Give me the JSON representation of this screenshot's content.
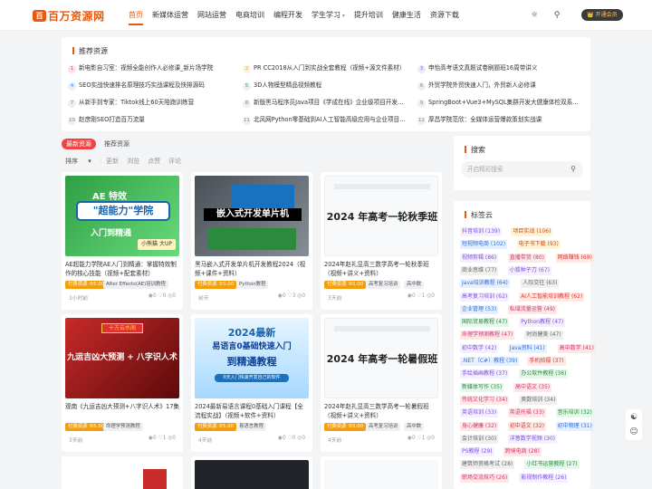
{
  "header": {
    "logo_mark": "百",
    "logo_text": "百万资源网",
    "nav": [
      {
        "label": "首页",
        "active": true
      },
      {
        "label": "新媒体运营"
      },
      {
        "label": "网站运营"
      },
      {
        "label": "电商培训"
      },
      {
        "label": "编程开发"
      },
      {
        "label": "学生学习"
      },
      {
        "label": "提升培训"
      },
      {
        "label": "健康生活"
      },
      {
        "label": "资源下载"
      }
    ],
    "vip_label": "👑 开通会员"
  },
  "recommend": {
    "title": "推荐资源",
    "items": [
      {
        "n": "1",
        "text": "新电影自习室：视频全能创作人必修课_新片场学院"
      },
      {
        "n": "2",
        "text": "PR CC2018从入门到实战全套教程（视频+源文件素材）"
      },
      {
        "n": "3",
        "text": "申怡高考语文真题试卷刷题班16周带讲义"
      },
      {
        "n": "4",
        "text": "SEO实战快速排名原理技巧实战课程及快排源码"
      },
      {
        "n": "5",
        "text": "3D人物模型精品视频教程"
      },
      {
        "n": "6",
        "text": "外贸学院外贸快速入门，外贸新人必修课"
      },
      {
        "n": "7",
        "text": "从新手到专家：Tiktok线上60天陪跑训练营"
      },
      {
        "n": "8",
        "text": "新版黑马程序员Java项目《学成在线》企业级项目开发实战"
      },
      {
        "n": "9",
        "text": "SpringBoot+Vue3+MySQL集群开发大健康体检双系统实战"
      },
      {
        "n": "10",
        "text": "赵彦刚SEO打造百万流量"
      },
      {
        "n": "11",
        "text": "北风网Python零基础到AI人工智能高级应用与企业项目实战"
      },
      {
        "n": "12",
        "text": "厚昌学院范欣：全媒体运营爆款策划实战课"
      }
    ]
  },
  "tabs": {
    "latest": "最新资源",
    "recommend": "推荐资源"
  },
  "sort": {
    "label": "排序",
    "items": [
      "更新",
      "浏览",
      "点赞",
      "评论"
    ]
  },
  "posts": [
    {
      "thumb": "AE 特效 \"超能力\"学院 入门到精通",
      "title": "AE超能力学院AE入门到精通：掌握特效制作的核心技能（视频+配套素材）",
      "tag": "After Effects(AE)培训教程",
      "time": "3小时前",
      "stats": "0  0  0"
    },
    {
      "thumb": "嵌入式开发单片机",
      "title": "黑马嵌入式开发单片机开发教程2024（视频+课件+资料）",
      "tag": "Python教程",
      "time": "前天",
      "stats": "0  3  0"
    },
    {
      "thumb": "2024 年高考一轮秋季班",
      "title": "2024年赵礼显高三数学高考一轮秋季班（视频+讲义+资料）",
      "tag": "高考复习培训",
      "tag2": "高中数",
      "time": "3天前",
      "stats": "0  1  0"
    },
    {
      "thumb": "九运吉凶大预测 + 八字识人术",
      "title": "观南《九运吉凶大预测+八字识人术》17集",
      "tag": "命理学预测教程",
      "time": "3天前",
      "stats": "0  0  0"
    },
    {
      "thumb": "2024最新 易语言0基础快速入门到精通教程",
      "title": "2024最新易语言课程0基础入门课程【全流程实战】（视频+软件+资料）",
      "tag": "易语言教程",
      "time": "4天前",
      "stats": "0  0  0"
    },
    {
      "thumb": "2024 年高考一轮暑假班",
      "title": "2024年赵礼显高三数学高考一轮暑假班（视频+讲义+资料）",
      "tag": "高考复习培训",
      "tag2": "高中数",
      "time": "4天前",
      "stats": "0  1  0"
    }
  ],
  "badge_paid": "付费资源",
  "sidebar": {
    "search_title": "搜索",
    "search_placeholder": "开启精彩搜索",
    "tags_title": "标签云",
    "tags": [
      {
        "t": "抖音培训",
        "c": "139"
      },
      {
        "t": "项目实战",
        "c": "106"
      },
      {
        "t": "短视频电商",
        "c": "102"
      },
      {
        "t": "电子书下载",
        "c": "93"
      },
      {
        "t": "视频剪辑",
        "c": "86"
      },
      {
        "t": "直播带货",
        "c": "80"
      },
      {
        "t": "网络赚钱",
        "c": "69"
      },
      {
        "t": "商业思维",
        "c": "77"
      },
      {
        "t": "小狐种子刀",
        "c": "67"
      },
      {
        "t": "Java培训教程",
        "c": "64"
      },
      {
        "t": "人际交往",
        "c": "63"
      },
      {
        "t": "高考复习培训",
        "c": "62"
      },
      {
        "t": "AI人工智能培训教程",
        "c": "62"
      },
      {
        "t": "企业管理",
        "c": "53"
      },
      {
        "t": "私域流量运营",
        "c": "49"
      },
      {
        "t": "国际贸易教程",
        "c": "47"
      },
      {
        "t": "Python教程",
        "c": "47"
      },
      {
        "t": "命理学预测教程",
        "c": "47"
      },
      {
        "t": "时尚健美",
        "c": "47"
      },
      {
        "t": "初中数学",
        "c": "42"
      },
      {
        "t": "Java资料",
        "c": "41"
      },
      {
        "t": "高中数学",
        "c": "41"
      },
      {
        "t": ".NET（C#）教程",
        "c": "39"
      },
      {
        "t": "手机拍摄",
        "c": "37"
      },
      {
        "t": "手绘插画教程",
        "c": "37"
      },
      {
        "t": "办公软件教程",
        "c": "36"
      },
      {
        "t": "新媒体写作",
        "c": "35"
      },
      {
        "t": "高中语文",
        "c": "35"
      },
      {
        "t": "传统文化学习",
        "c": "34"
      },
      {
        "t": "奥数培训",
        "c": "34"
      },
      {
        "t": "英语培训",
        "c": "33"
      },
      {
        "t": "英语托福",
        "c": "33"
      },
      {
        "t": "音乐培训",
        "c": "32"
      },
      {
        "t": "身心健康",
        "c": "32"
      },
      {
        "t": "初中语文",
        "c": "32"
      },
      {
        "t": "初中物理",
        "c": "31"
      },
      {
        "t": "会计培训",
        "c": "30"
      },
      {
        "t": "洋葱数学视频",
        "c": "30"
      },
      {
        "t": "PS教程",
        "c": "29"
      },
      {
        "t": "跨境电商",
        "c": "28"
      },
      {
        "t": "建筑师资格考试",
        "c": "28"
      },
      {
        "t": "小红书运营教程",
        "c": "27"
      },
      {
        "t": "职场交流技巧",
        "c": "26"
      },
      {
        "t": "影视制作教程",
        "c": "26"
      }
    ]
  }
}
